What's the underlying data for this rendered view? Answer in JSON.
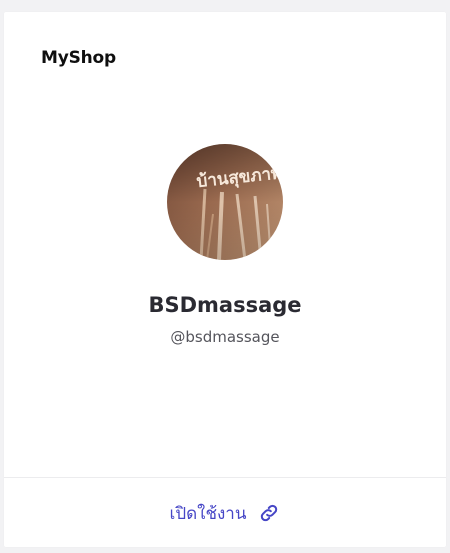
{
  "brand": "MyShop",
  "profile": {
    "name": "BSDmassage",
    "handle": "@bsdmassage",
    "avatar_text": "บ้านสุขภาพดี"
  },
  "footer": {
    "open_label": "เปิดใช้งาน",
    "icon": "link-icon"
  },
  "colors": {
    "accent": "#4646c6",
    "title": "#2a2a32",
    "handle": "#55555c"
  }
}
